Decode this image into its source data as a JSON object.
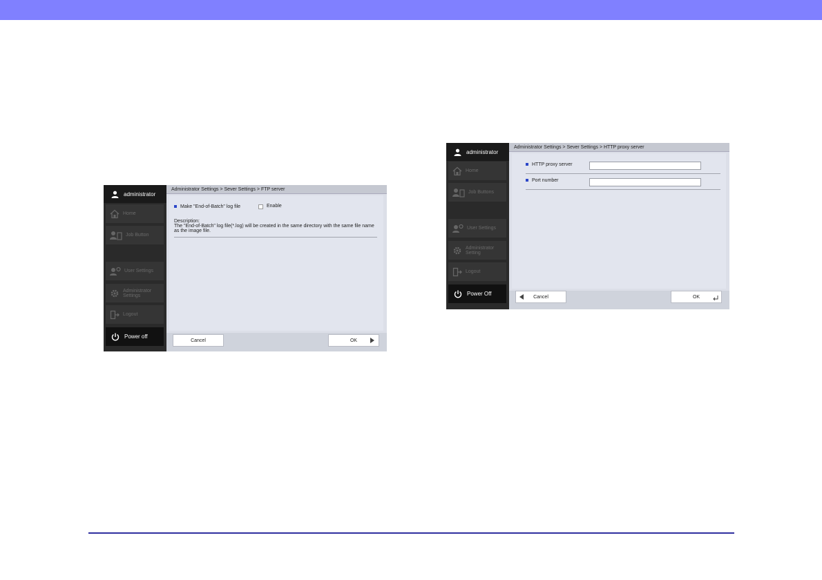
{
  "screen1": {
    "user": "administrator",
    "nav": [
      {
        "label": "Home",
        "icon": "home-icon"
      },
      {
        "label": "Job Button",
        "icon": "job-button-icon"
      },
      {
        "label": "User Settings",
        "icon": "user-settings-icon"
      },
      {
        "label": "Administrator Settings",
        "icon": "gear-icon"
      },
      {
        "label": "Logout",
        "icon": "logout-icon"
      }
    ],
    "power_label": "Power off",
    "breadcrumb": "Administrator Settings > Sever Settings > FTP server",
    "option_label": "Make \"End-of-Batch\" log file",
    "enable_label": "Enable",
    "description_title": "Description:",
    "description_text": "The \"End-of-Batch\" log file(*.log) will be created in the same directory with the same file name as the image file.",
    "cancel_label": "Cancel",
    "ok_label": "OK"
  },
  "screen2": {
    "user": "administrator",
    "nav": [
      {
        "label": "Home",
        "icon": "home-icon"
      },
      {
        "label": "Job Buttons",
        "icon": "job-button-icon"
      },
      {
        "label": "User Settings",
        "icon": "user-settings-icon"
      },
      {
        "label": "Administrator Setting",
        "icon": "gear-icon"
      },
      {
        "label": "Logout",
        "icon": "logout-icon"
      }
    ],
    "power_label": "Power Off",
    "breadcrumb": "Administrator Settings > Sever Settings > HTTP proxy server",
    "fields": [
      {
        "label": "HTTP proxy server",
        "value": ""
      },
      {
        "label": "Port number",
        "value": ""
      }
    ],
    "cancel_label": "Cancel",
    "ok_label": "OK"
  }
}
